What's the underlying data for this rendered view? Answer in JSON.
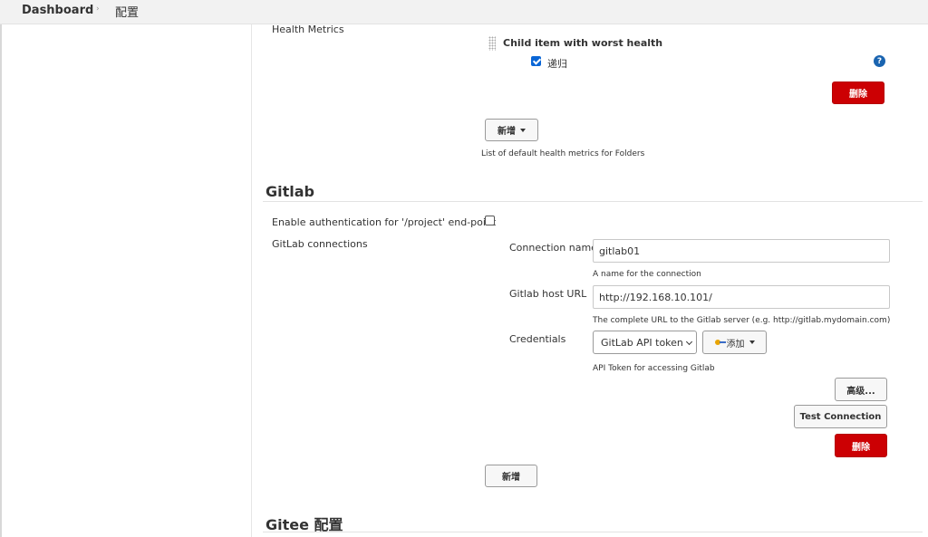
{
  "breadcrumb": {
    "home": "Dashboard",
    "separator": "›",
    "current": "配置"
  },
  "health_metrics": {
    "label": "Health Metrics",
    "item_title": "Child item with worst health",
    "recursive_label": "递归",
    "recursive_checked": true,
    "help_icon": "?",
    "delete_label": "删除",
    "add_label": "新增",
    "description": "List of default health metrics for Folders"
  },
  "gitlab": {
    "title": "Gitlab",
    "auth_label": "Enable authentication for '/project' end-point",
    "auth_checked": false,
    "connections_label": "GitLab connections",
    "connection_name_label": "Connection name",
    "connection_name_value": "gitlab01",
    "connection_name_help": "A name for the connection",
    "host_url_label": "Gitlab host URL",
    "host_url_value": "http://192.168.10.101/",
    "host_url_help": "The complete URL to the Gitlab server (e.g. http://gitlab.mydomain.com)",
    "credentials_label": "Credentials",
    "credentials_selected": "GitLab API token",
    "credentials_add_label": "添加",
    "credentials_help": "API Token for accessing Gitlab",
    "advanced_label": "高级...",
    "test_connection_label": "Test Connection",
    "delete_label": "删除",
    "add_label": "新增"
  },
  "gitee": {
    "title": "Gitee 配置"
  },
  "colors": {
    "danger": "#cc0003",
    "accent": "#0a66d6",
    "help": "#1a64b0"
  },
  "icons": {
    "help": "help-icon",
    "key": "key-icon",
    "caret": "caret-down-icon",
    "drag": "drag-handle-icon",
    "chevron": "chevron-right-icon"
  }
}
